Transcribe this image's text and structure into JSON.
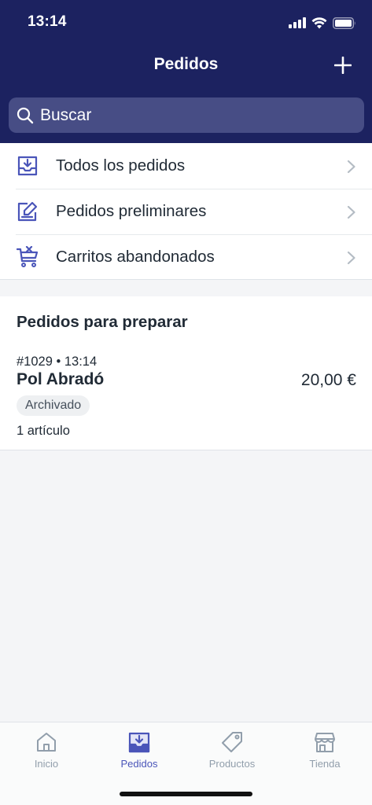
{
  "status_bar": {
    "time": "13:14"
  },
  "header": {
    "title": "Pedidos"
  },
  "search": {
    "placeholder": "Buscar"
  },
  "menu": {
    "items": [
      {
        "label": "Todos los pedidos",
        "icon": "inbox-download-icon"
      },
      {
        "label": "Pedidos preliminares",
        "icon": "draft-edit-icon"
      },
      {
        "label": "Carritos abandonados",
        "icon": "cart-remove-icon"
      }
    ]
  },
  "orders_section": {
    "title": "Pedidos para preparar",
    "orders": [
      {
        "number": "#1029",
        "time": "13:14",
        "customer": "Pol Abradó",
        "total": "20,00 €",
        "status": "Archivado",
        "items": "1 artículo"
      }
    ]
  },
  "tab_bar": {
    "tabs": [
      {
        "label": "Inicio",
        "icon": "home-icon",
        "active": false
      },
      {
        "label": "Pedidos",
        "icon": "orders-icon",
        "active": true
      },
      {
        "label": "Productos",
        "icon": "tag-icon",
        "active": false
      },
      {
        "label": "Tienda",
        "icon": "store-icon",
        "active": false
      }
    ]
  },
  "colors": {
    "header_bg": "#1c2260",
    "search_bg": "#474d85",
    "accent": "#4a55b9",
    "inactive_tab": "#919eab"
  }
}
